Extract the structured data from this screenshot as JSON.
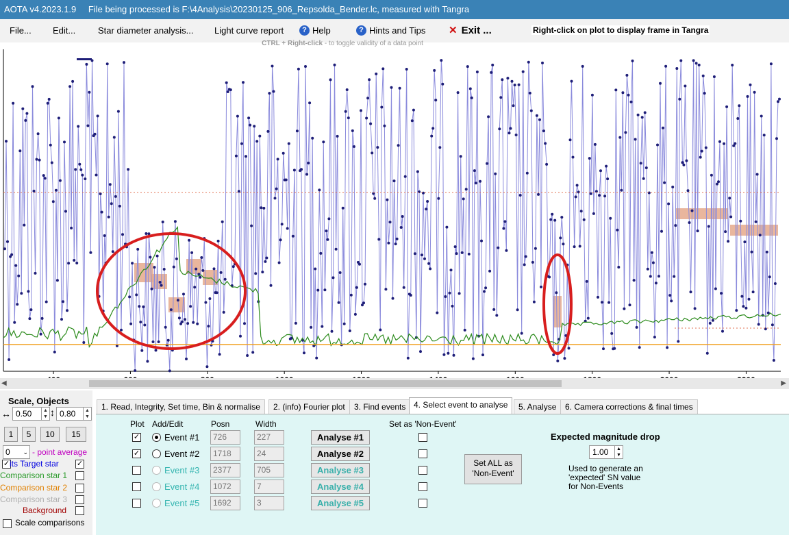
{
  "titlebar": {
    "app_version": "AOTA v4.2023.1.9",
    "file_status": "File being processed is F:\\4Analysis\\20230125_906_Repsolda_Bender.lc, measured with Tangra"
  },
  "menu": {
    "file": "File...",
    "edit": "Edit...",
    "star_diameter": "Star diameter analysis...",
    "light_curve_report": "Light curve report",
    "help": "Help",
    "hints": "Hints and Tips",
    "exit": "Exit ..."
  },
  "hints": {
    "right_click": "Right-click on plot to display frame in Tangra",
    "ctrl_prefix": "CTRL + Right-click",
    "ctrl_suffix": "  -  to toggle validity of a data point"
  },
  "colors": {
    "titlebar": "#3a82b6",
    "series_line": "#8a8adc",
    "series_point": "#1e1e78",
    "comparison_line": "#2a8a1a",
    "baseline": "#f0a020",
    "event_box": "#e5a98c",
    "circle": "#d81e1e",
    "tab_body": "#dff6f5"
  },
  "chart_data": {
    "type": "line",
    "x_tick_labels": [
      "400",
      "600",
      "800",
      "1000",
      "1200",
      "1400",
      "1600",
      "1800",
      "2000",
      "2200"
    ],
    "x_ticks": [
      400,
      600,
      800,
      1000,
      1200,
      1400,
      1600,
      1800,
      2000,
      2200
    ],
    "xlim": [
      270,
      2290
    ],
    "series": [
      {
        "values": []
      },
      {
        "values": []
      }
    ],
    "grid": false
  },
  "scale_panel": {
    "title": "Scale,  Objects",
    "x_scale": "0.50",
    "y_scale": "0.80",
    "buttons": [
      "1",
      "5",
      "10",
      "15"
    ],
    "avg_value": "0",
    "avg_label": "- point average",
    "legend": [
      {
        "label": "its  Target star",
        "color": "#0000e0",
        "checked": true
      },
      {
        "label": "Comparison star 1",
        "color": "#2a9a2a",
        "checked": false
      },
      {
        "label": "Comparison star 2",
        "color": "#e08000",
        "checked": false
      },
      {
        "label": "Comparison star 3",
        "color": "#b0b0b0",
        "checked": false
      },
      {
        "label": "Background",
        "color": "#a00000",
        "checked": false
      },
      {
        "label": "Scale comparisons",
        "color": "#000000",
        "checked": false
      }
    ]
  },
  "tabs": [
    "1.  Read, Integrity, Set time, Bin & normalise",
    "2. (info)  Fourier plot",
    "3. Find events",
    "4. Select event to analyse",
    "5. Analyse",
    "6. Camera corrections & final times"
  ],
  "events_panel": {
    "headers": {
      "plot": "Plot",
      "add_edit": "Add/Edit",
      "posn": "Posn",
      "width": "Width",
      "set_non_event": "Set as 'Non-Event'"
    },
    "events": [
      {
        "label": "Event #1",
        "posn": "726",
        "width": "227",
        "analyse": "Analyse #1",
        "plot": true,
        "selected": true,
        "enabled": true
      },
      {
        "label": "Event #2",
        "posn": "1718",
        "width": "24",
        "analyse": "Analyse #2",
        "plot": true,
        "selected": false,
        "enabled": true
      },
      {
        "label": "Event #3",
        "posn": "2377",
        "width": "705",
        "analyse": "Analyse #3",
        "plot": false,
        "selected": false,
        "enabled": false
      },
      {
        "label": "Event #4",
        "posn": "1072",
        "width": "7",
        "analyse": "Analyse #4",
        "plot": false,
        "selected": false,
        "enabled": false
      },
      {
        "label": "Event #5",
        "posn": "1692",
        "width": "3",
        "analyse": "Analyse #5",
        "plot": false,
        "selected": false,
        "enabled": false
      }
    ],
    "set_all_line1": "Set ALL as",
    "set_all_line2": "'Non-Event'",
    "expected_title": "Expected magnitude drop",
    "expected_value": "1.00",
    "expected_note": "Used to generate an\n'expected' SN value\nfor Non-Events"
  }
}
